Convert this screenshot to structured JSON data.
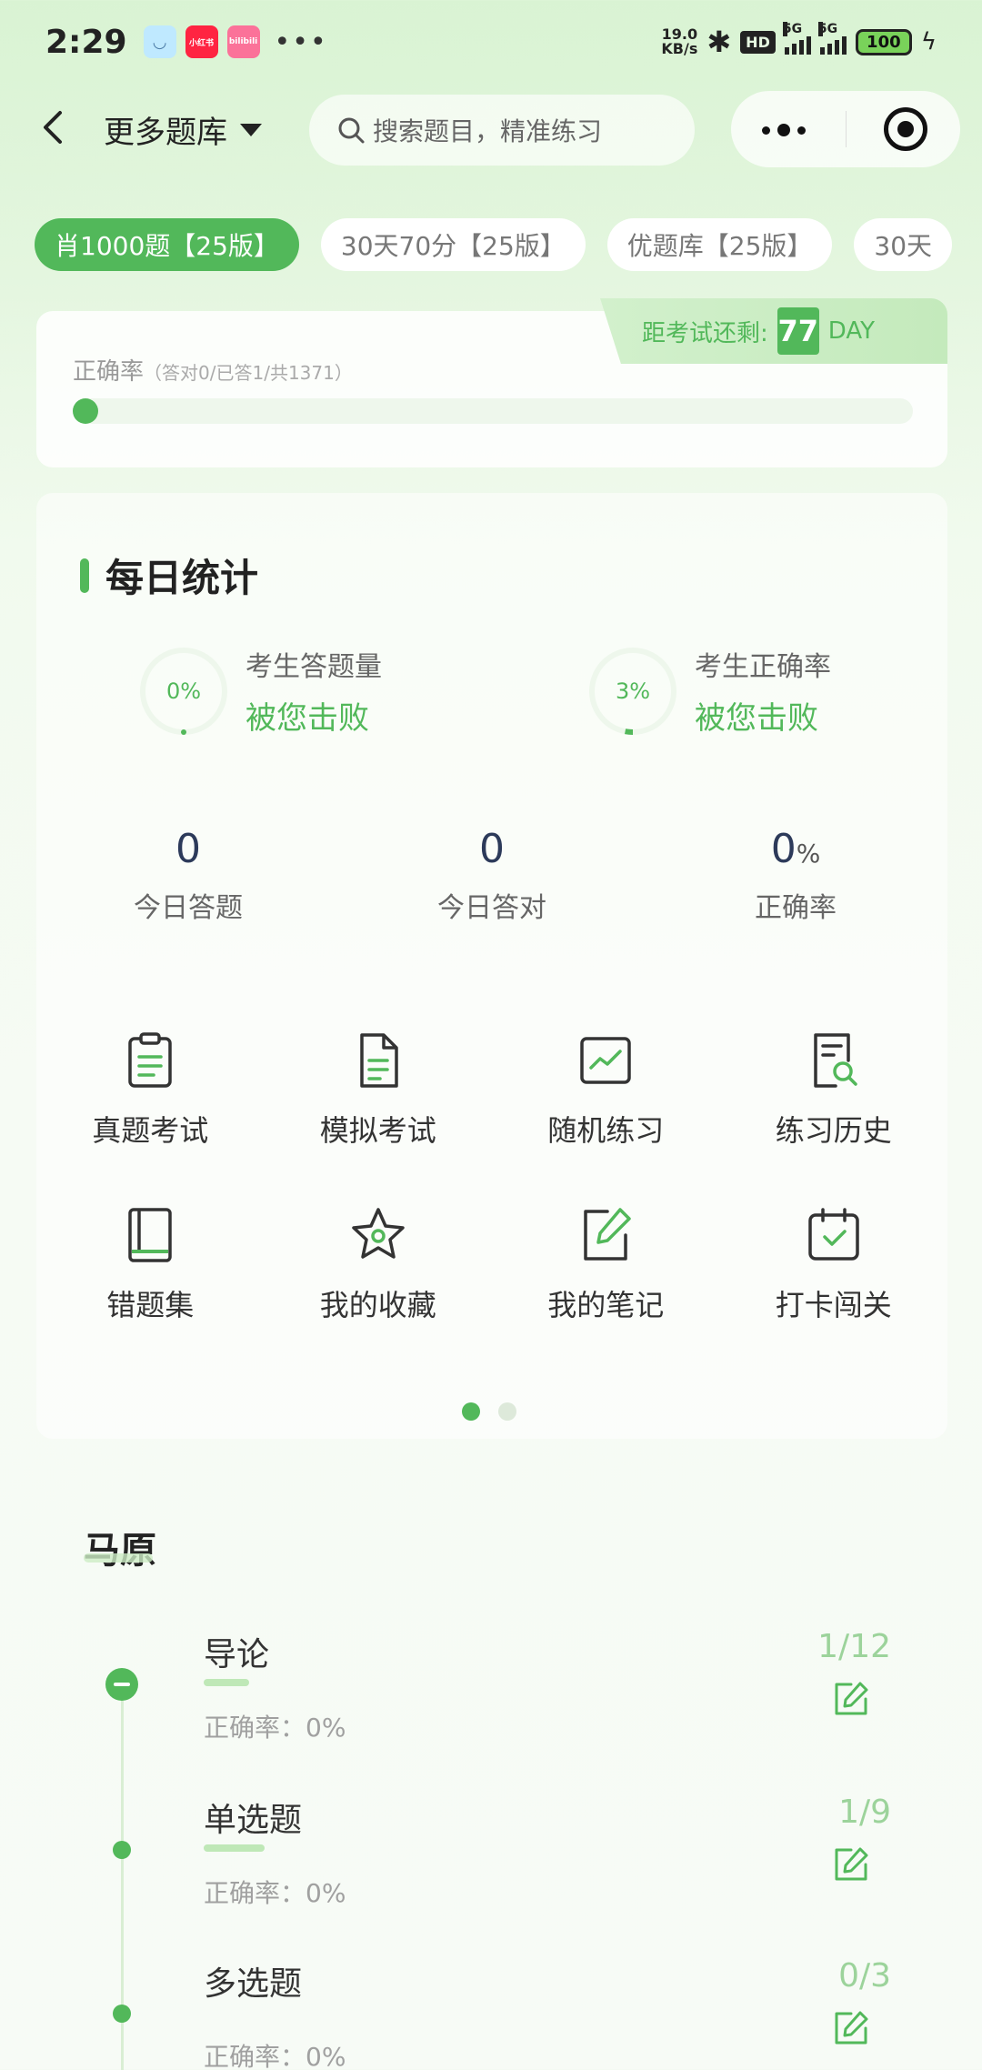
{
  "status": {
    "time": "2:29",
    "speed_value": "19.0",
    "speed_unit": "KB/s",
    "hd": "HD",
    "sig1": "5G",
    "sig2": "5G",
    "battery": "100",
    "app1": "小红书",
    "app2": "bilibili"
  },
  "nav": {
    "title": "更多题库",
    "search_placeholder": "搜索题目，精准练习"
  },
  "tabs": [
    {
      "label": "肖1000题【25版】",
      "active": true
    },
    {
      "label": "30天70分【25版】",
      "active": false
    },
    {
      "label": "优题库【25版】",
      "active": false
    },
    {
      "label": "30天",
      "active": false
    }
  ],
  "accuracy": {
    "label": "正确率",
    "detail": "（答对0/已答1/共1371）",
    "progress_fraction": 0.0,
    "countdown_label": "距考试还剩:",
    "countdown_days": "77",
    "countdown_unit": "DAY"
  },
  "daily": {
    "title": "每日统计",
    "stat1": {
      "percent": "0%",
      "fraction": 0.0,
      "line1": "考生答题量",
      "line2": "被您击败"
    },
    "stat2": {
      "percent": "3%",
      "fraction": 0.03,
      "line1": "考生正确率",
      "line2": "被您击败"
    },
    "today_answered": "0",
    "today_answered_label": "今日答题",
    "today_correct": "0",
    "today_correct_label": "今日答对",
    "rate": "0",
    "rate_unit": "%",
    "rate_label": "正确率"
  },
  "grid": [
    {
      "label": "真题考试",
      "icon": "clipboard-icon"
    },
    {
      "label": "模拟考试",
      "icon": "document-icon"
    },
    {
      "label": "随机练习",
      "icon": "chart-icon"
    },
    {
      "label": "练习历史",
      "icon": "history-icon"
    },
    {
      "label": "错题集",
      "icon": "book-icon"
    },
    {
      "label": "我的收藏",
      "icon": "star-icon"
    },
    {
      "label": "我的笔记",
      "icon": "note-icon"
    },
    {
      "label": "打卡闯关",
      "icon": "calendar-check-icon"
    }
  ],
  "pager": {
    "pages": 2,
    "current": 1
  },
  "chapter": {
    "title": "马原",
    "items": [
      {
        "title": "导论",
        "accuracy": "正确率：0%",
        "count": "1/12",
        "fraction": 0.083
      },
      {
        "title": "单选题",
        "accuracy": "正确率：0%",
        "count": "1/9",
        "fraction": 0.111
      },
      {
        "title": "多选题",
        "accuracy": "正确率：0%",
        "count": "0/3",
        "fraction": 0.0
      }
    ]
  },
  "colors": {
    "accent": "#52b85a",
    "accent_light": "#d2f0cc"
  }
}
